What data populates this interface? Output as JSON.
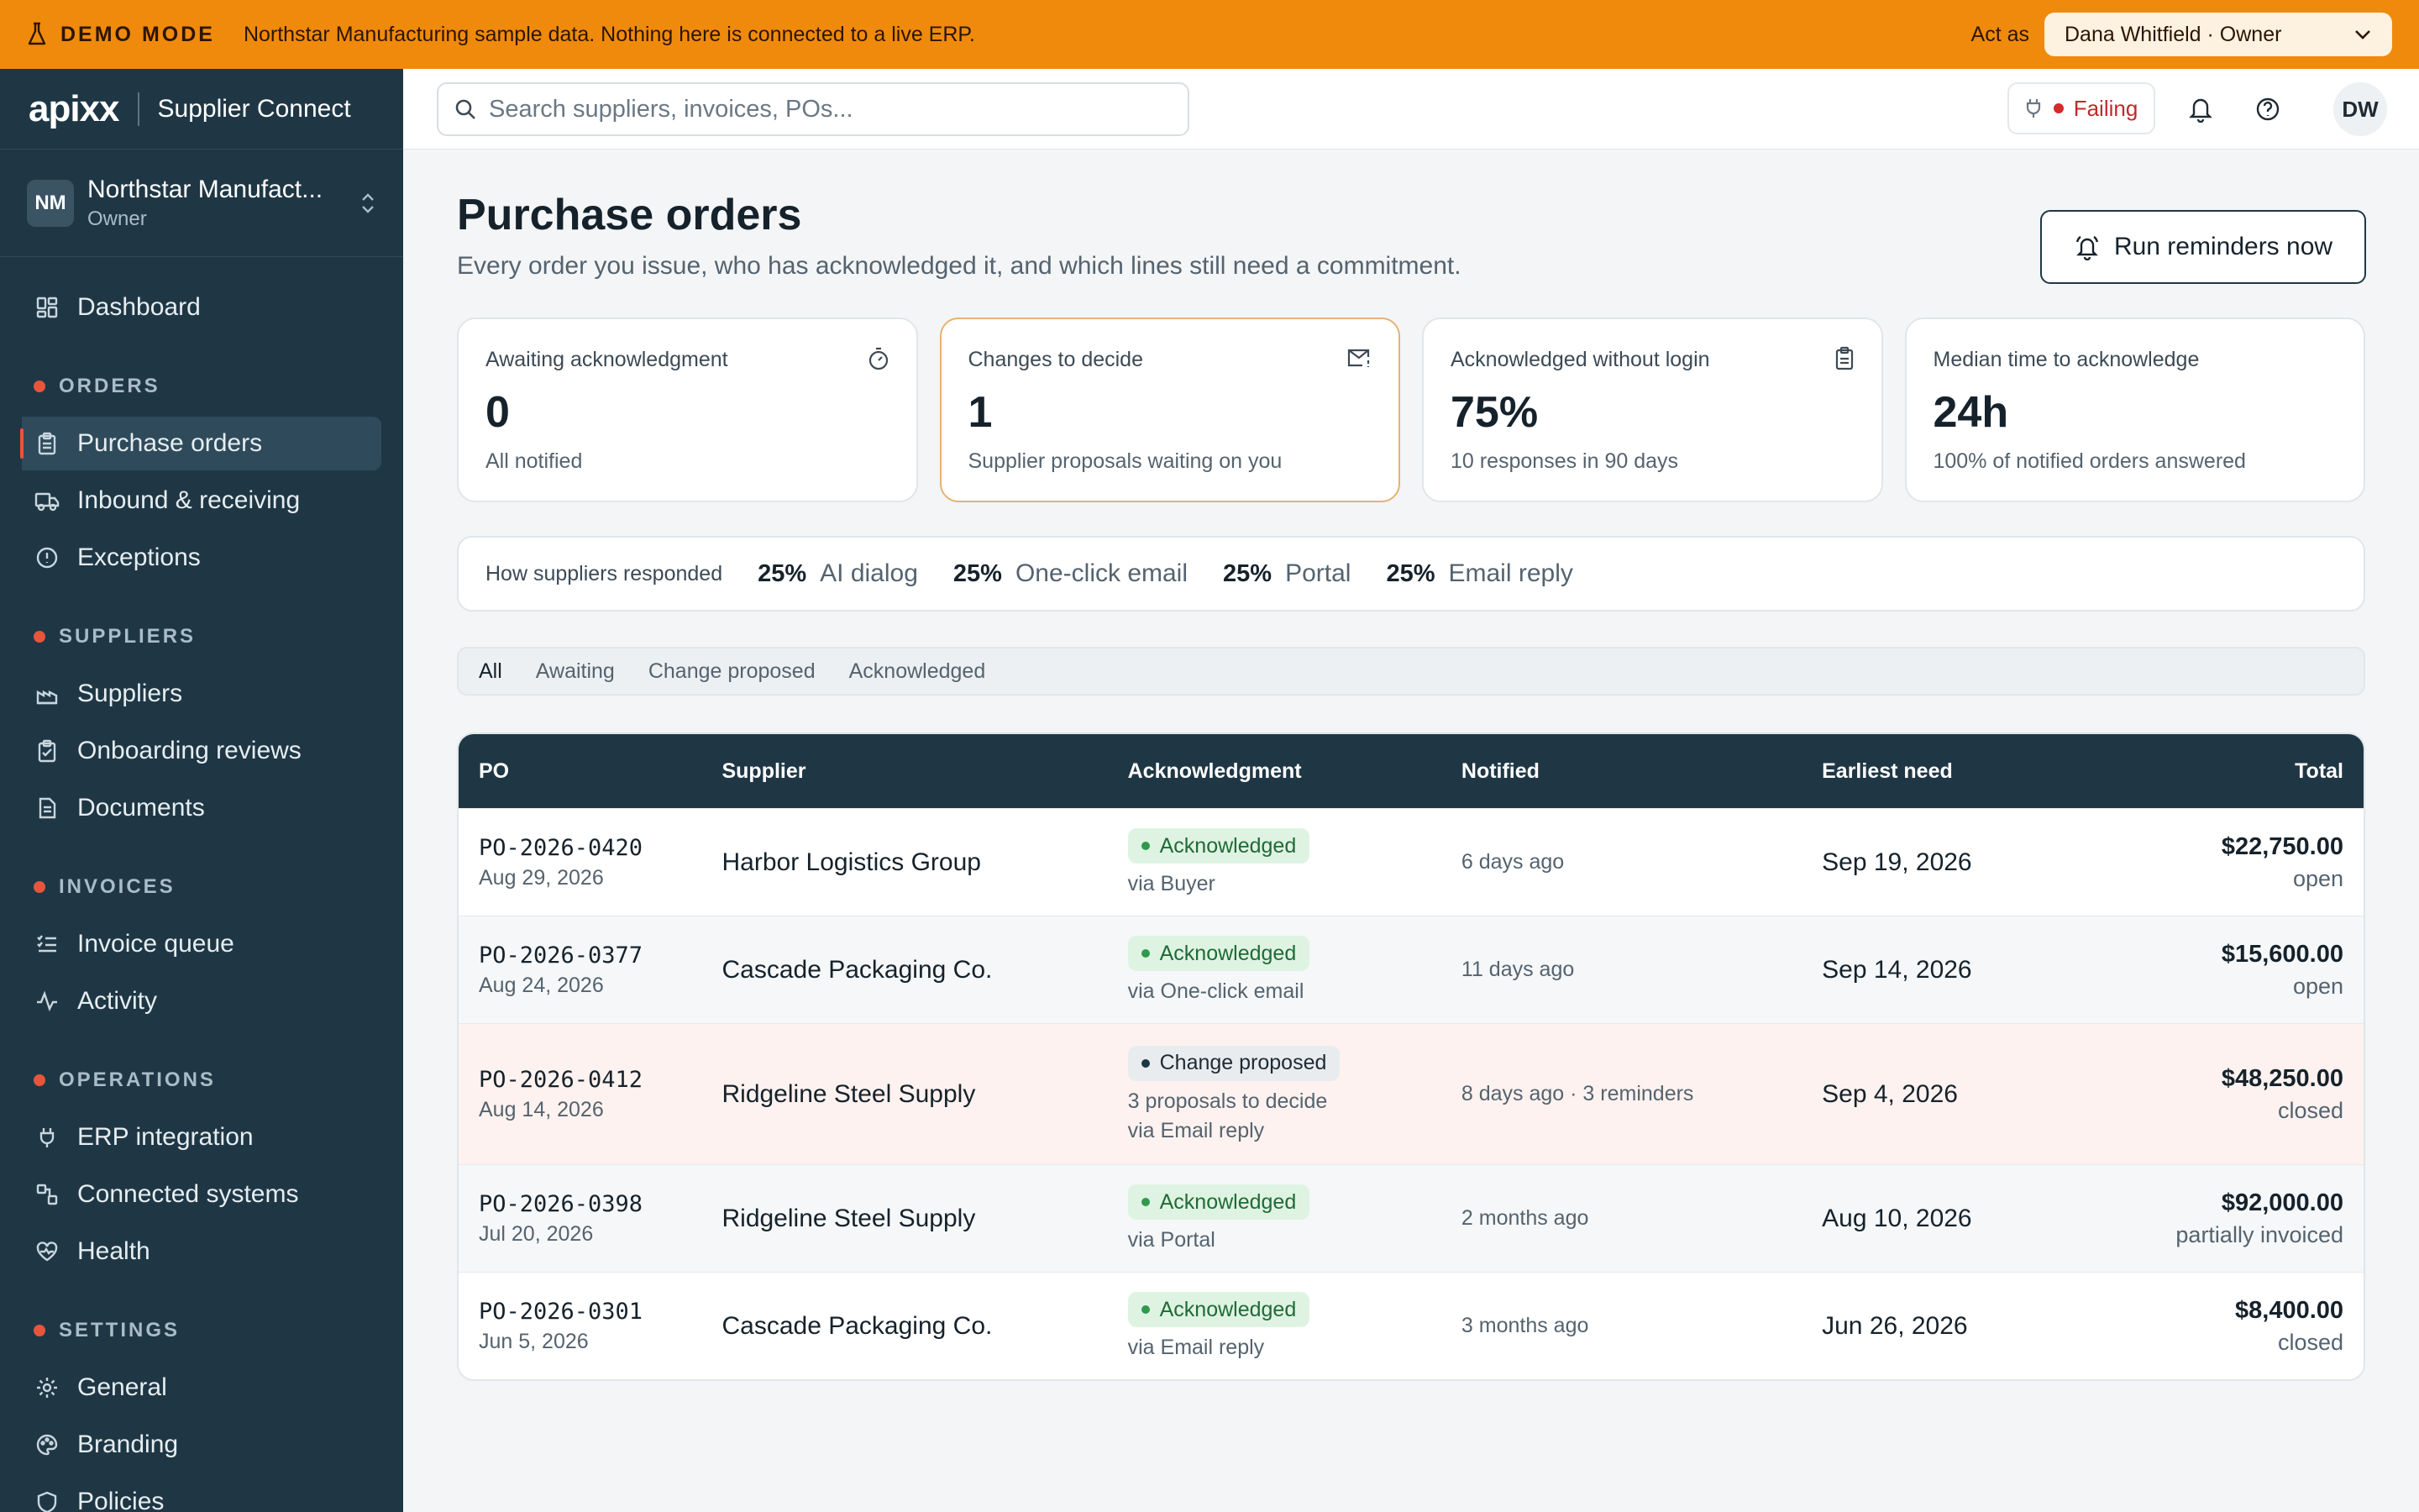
{
  "banner": {
    "demo_label": "DEMO MODE",
    "message": "Northstar Manufacturing sample data. Nothing here is connected to a live ERP.",
    "act_as_label": "Act as",
    "act_as_value": "Dana Whitfield · Owner"
  },
  "brand": {
    "logo": "apixx",
    "product": "Supplier Connect"
  },
  "org": {
    "initials": "NM",
    "name": "Northstar Manufact...",
    "role": "Owner"
  },
  "sidebar": {
    "dashboard": "Dashboard",
    "sections": [
      {
        "title": "ORDERS",
        "items": [
          "Purchase orders",
          "Inbound & receiving",
          "Exceptions"
        ]
      },
      {
        "title": "SUPPLIERS",
        "items": [
          "Suppliers",
          "Onboarding reviews",
          "Documents"
        ]
      },
      {
        "title": "INVOICES",
        "items": [
          "Invoice queue",
          "Activity"
        ]
      },
      {
        "title": "OPERATIONS",
        "items": [
          "ERP integration",
          "Connected systems",
          "Health"
        ]
      },
      {
        "title": "SETTINGS",
        "items": [
          "General",
          "Branding",
          "Policies"
        ]
      }
    ]
  },
  "topbar": {
    "search_placeholder": "Search suppliers, invoices, POs...",
    "status": "Failing",
    "user_initials": "DW"
  },
  "page": {
    "title": "Purchase orders",
    "subtitle": "Every order you issue, who has acknowledged it, and which lines still need a commitment.",
    "run_button": "Run reminders now"
  },
  "cards": [
    {
      "label": "Awaiting acknowledgment",
      "value": "0",
      "sub": "All notified",
      "icon": "timer-icon"
    },
    {
      "label": "Changes to decide",
      "value": "1",
      "sub": "Supplier proposals waiting on you",
      "icon": "mail-icon"
    },
    {
      "label": "Acknowledged without login",
      "value": "75%",
      "sub": "10 responses in 90 days",
      "icon": "clipboard-icon"
    },
    {
      "label": "Median time to acknowledge",
      "value": "24h",
      "sub": "100% of notified orders answered",
      "icon": ""
    }
  ],
  "responded": {
    "label": "How suppliers responded",
    "methods": [
      {
        "pct": "25%",
        "name": "AI dialog"
      },
      {
        "pct": "25%",
        "name": "One-click email"
      },
      {
        "pct": "25%",
        "name": "Portal"
      },
      {
        "pct": "25%",
        "name": "Email reply"
      }
    ]
  },
  "filters": [
    "All",
    "Awaiting",
    "Change proposed",
    "Acknowledged"
  ],
  "table": {
    "headers": {
      "po": "PO",
      "supplier": "Supplier",
      "ack": "Acknowledgment",
      "notified": "Notified",
      "need": "Earliest need",
      "total": "Total"
    },
    "rows": [
      {
        "po": "PO-2026-0420",
        "date": "Aug 29, 2026",
        "supplier": "Harbor Logistics Group",
        "status": "Acknowledged",
        "note1": "via Buyer",
        "note2": "",
        "notified": "6 days ago",
        "need": "Sep 19, 2026",
        "amount": "$22,750.00",
        "state": "open"
      },
      {
        "po": "PO-2026-0377",
        "date": "Aug 24, 2026",
        "supplier": "Cascade Packaging Co.",
        "status": "Acknowledged",
        "note1": "via One-click email",
        "note2": "",
        "notified": "11 days ago",
        "need": "Sep 14, 2026",
        "amount": "$15,600.00",
        "state": "open"
      },
      {
        "po": "PO-2026-0412",
        "date": "Aug 14, 2026",
        "supplier": "Ridgeline Steel Supply",
        "status": "Change proposed",
        "note1": "3 proposals to decide",
        "note2": "via Email reply",
        "notified": "8 days ago · 3 reminders",
        "need": "Sep 4, 2026",
        "amount": "$48,250.00",
        "state": "closed"
      },
      {
        "po": "PO-2026-0398",
        "date": "Jul 20, 2026",
        "supplier": "Ridgeline Steel Supply",
        "status": "Acknowledged",
        "note1": "via Portal",
        "note2": "",
        "notified": "2 months ago",
        "need": "Aug 10, 2026",
        "amount": "$92,000.00",
        "state": "partially invoiced"
      },
      {
        "po": "PO-2026-0301",
        "date": "Jun 5, 2026",
        "supplier": "Cascade Packaging Co.",
        "status": "Acknowledged",
        "note1": "via Email reply",
        "note2": "",
        "notified": "3 months ago",
        "need": "Jun 26, 2026",
        "amount": "$8,400.00",
        "state": "closed"
      }
    ]
  }
}
